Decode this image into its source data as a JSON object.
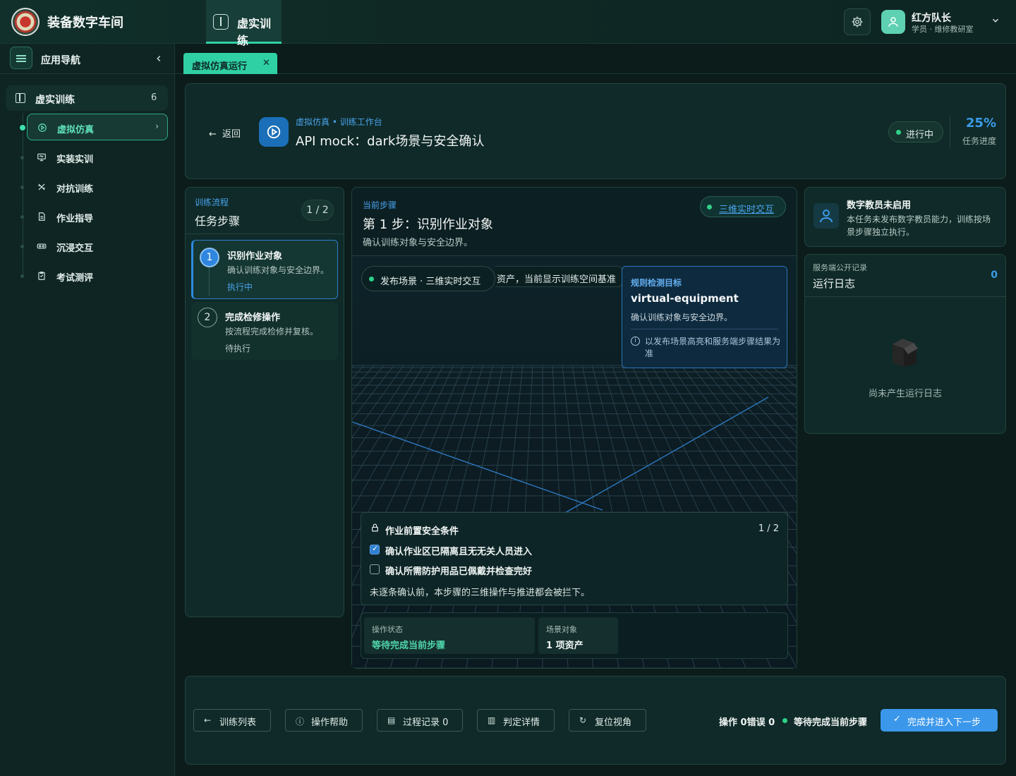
{
  "header": {
    "app_title": "装备数字车间",
    "module_tab": "虚实训练",
    "user_name": "红方队长",
    "user_role": "学员 · 维修教研室"
  },
  "sidebar": {
    "title": "应用导航",
    "group": {
      "label": "虚实训练",
      "count": "6"
    },
    "items": [
      {
        "label": "虚拟仿真",
        "icon": "play-circle-icon",
        "active": true
      },
      {
        "label": "实装实训",
        "icon": "monitor-icon"
      },
      {
        "label": "对抗训练",
        "icon": "sword-icon"
      },
      {
        "label": "作业指导",
        "icon": "document-icon"
      },
      {
        "label": "沉浸交互",
        "icon": "vr-headset-icon"
      },
      {
        "label": "考试测评",
        "icon": "clipboard-icon"
      }
    ]
  },
  "tabs": [
    {
      "label": "虚拟仿真运行"
    }
  ],
  "task": {
    "back_label": "返回",
    "kicker": "虚拟仿真 • 训练工作台",
    "title": "API mock：dark场景与安全确认",
    "status": "进行中",
    "progress": "25%",
    "progress_label": "任务进度"
  },
  "steps": {
    "kicker": "训练流程",
    "title": "任务步骤",
    "count": "1 / 2",
    "items": [
      {
        "num": "1",
        "name": "识别作业对象",
        "desc": "确认训练对象与安全边界。",
        "state": "执行中"
      },
      {
        "num": "2",
        "name": "完成检修操作",
        "desc": "按流程完成检修并复核。",
        "state": "待执行"
      }
    ]
  },
  "stage": {
    "kicker": "当前步骤",
    "title": "第 1 步：识别作业对象",
    "desc": "确认训练对象与安全边界。",
    "mode_pill": "三维实时交互",
    "scene_tag": "发布场景 · 三维实时交互",
    "scene_caption": "资产，当前显示训练空间基准",
    "target": {
      "kicker": "规则检测目标",
      "name": "virtual-equipment",
      "desc": "确认训练对象与安全边界。",
      "note": "以发布场景高亮和服务端步骤结果为准"
    },
    "safety": {
      "title": "作业前置安全条件",
      "count": "1 / 2",
      "items": [
        {
          "label": "确认作业区已隔离且无无关人员进入",
          "checked": true
        },
        {
          "label": "确认所需防护用品已佩戴并检查完好",
          "checked": false
        }
      ],
      "note": "未逐条确认前，本步骤的三维操作与推进都会被拦下。"
    },
    "status": {
      "op_label": "操作状态",
      "op_value": "等待完成当前步骤",
      "obj_label": "场景对象",
      "obj_value": "1 项资产"
    }
  },
  "tutor": {
    "title": "数字教员未启用",
    "desc": "本任务未发布数字教员能力，训练按场景步骤独立执行。"
  },
  "log": {
    "kicker": "服务端公开记录",
    "title": "运行日志",
    "count": "0",
    "empty": "尚未产生运行日志"
  },
  "footer": {
    "list": "训练列表",
    "help": "操作帮助",
    "record": "过程记录 0",
    "judge": "判定详情",
    "reset": "复位视角",
    "ops": "操作 0错误 0",
    "state": "等待完成当前步骤",
    "next": "完成并进入下一步"
  },
  "colors": {
    "accent_green": "#2fd0a4",
    "accent_blue": "#3b97ea",
    "background": "#0b1c1b"
  }
}
